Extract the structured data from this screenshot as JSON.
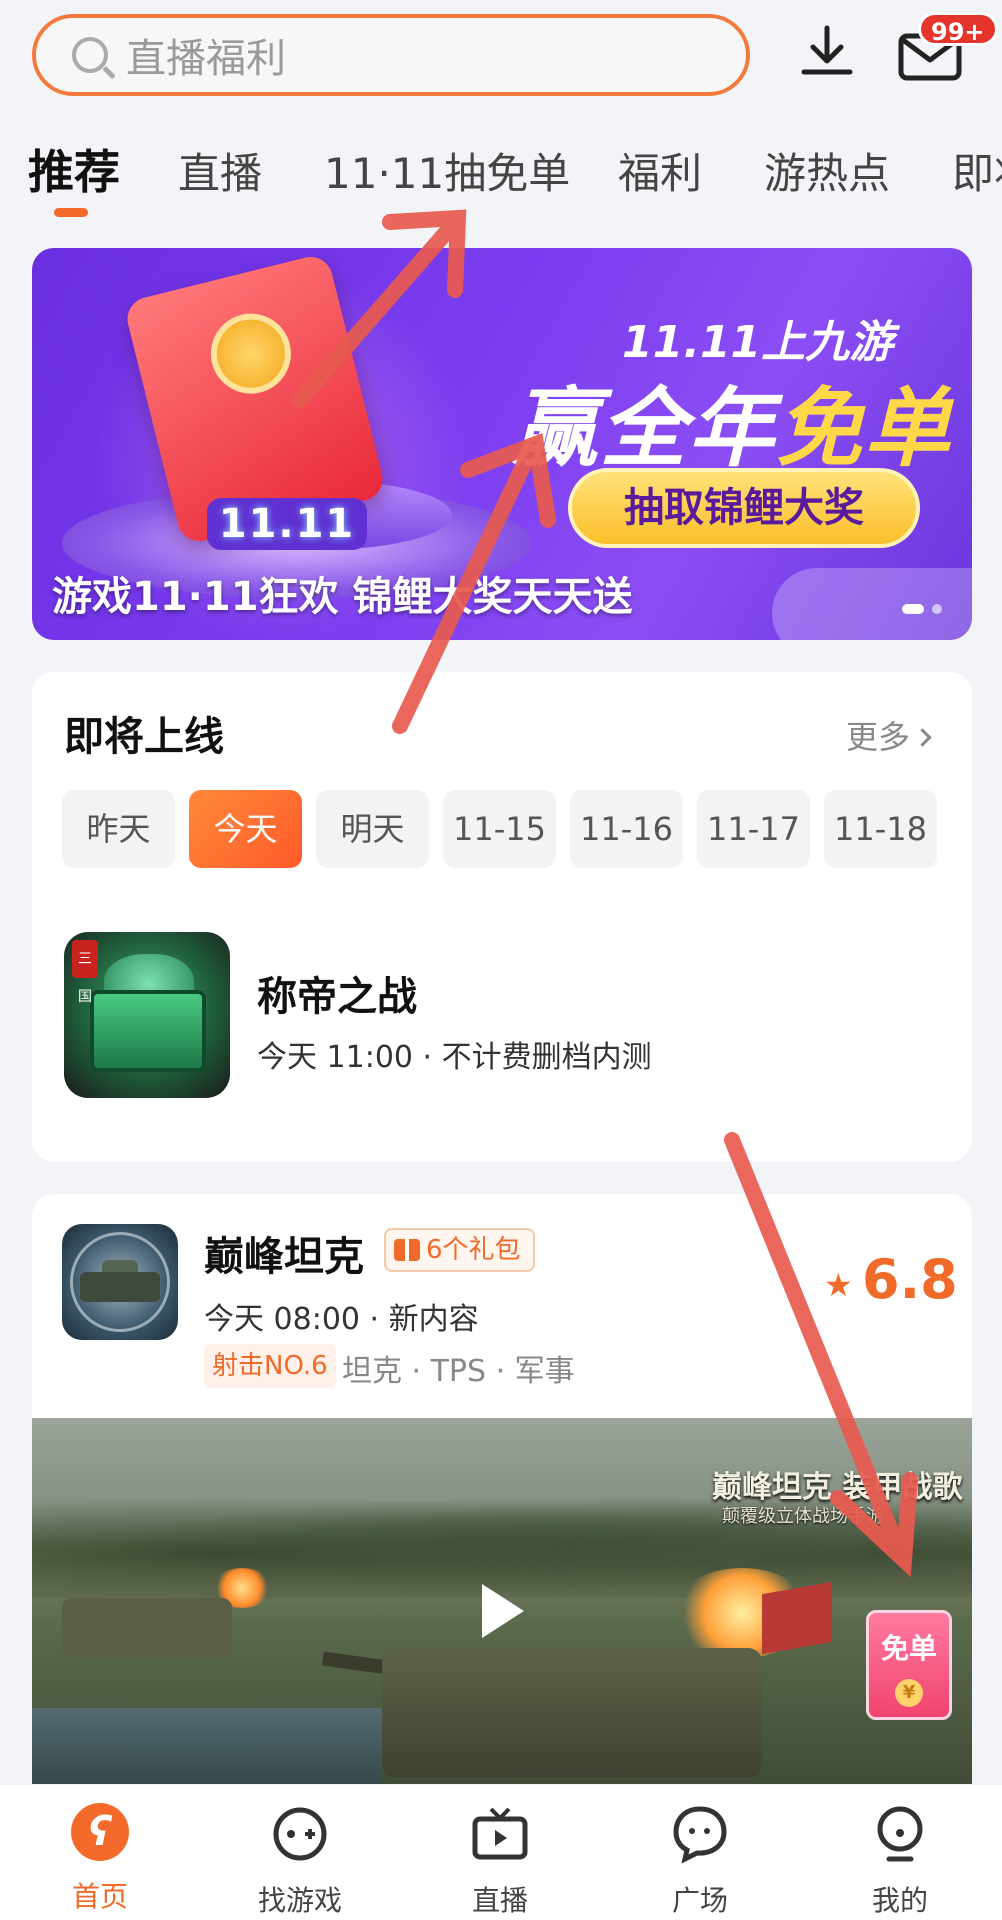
{
  "search": {
    "placeholder": "直播福利"
  },
  "header": {
    "mail_badge": "99+"
  },
  "tabs": [
    {
      "label": "推荐",
      "active": true
    },
    {
      "label": "直播"
    },
    {
      "label": "11·11抽免单"
    },
    {
      "label": "福利"
    },
    {
      "label": "游热点"
    },
    {
      "label": "即将"
    }
  ],
  "banner": {
    "title_small": "11.11上九游",
    "title_big_white": "赢全年",
    "title_big_gold": "免单",
    "button": "抽取锦鲤大奖",
    "pedestal_text": "11.11",
    "caption": "游戏11·11狂欢 锦鲤大奖天天送"
  },
  "upcoming": {
    "heading": "即将上线",
    "more": "更多",
    "dates": [
      "昨天",
      "今天",
      "明天",
      "11-15",
      "11-16",
      "11-17",
      "11-18"
    ],
    "active_date": "今天",
    "game": {
      "name": "称帝之战",
      "schedule": "今天 11:00 · 不计费删档内测",
      "icon_badge": "三国"
    }
  },
  "featured_game": {
    "name": "巅峰坦克",
    "gift_tag": "6个礼包",
    "schedule": "今天 08:00 · 新内容",
    "rank_tag": "射击NO.6",
    "tags": "坦克 · TPS · 军事",
    "rating": "6.8",
    "video_title": "巅峰坦克 装甲战歌",
    "video_subtitle": "颠覆级立体战场手游"
  },
  "floating_button": {
    "label": "免单",
    "coin": "¥"
  },
  "bottom_nav": [
    {
      "label": "首页",
      "icon": "home-icon",
      "active": true
    },
    {
      "label": "找游戏",
      "icon": "gamepad-icon"
    },
    {
      "label": "直播",
      "icon": "tv-icon"
    },
    {
      "label": "广场",
      "icon": "chat-bubble-icon"
    },
    {
      "label": "我的",
      "icon": "profile-icon"
    }
  ],
  "colors": {
    "accent": "#f46a2b",
    "banner_purple": "#7b3df0",
    "arrow_red": "#e85a4f"
  }
}
